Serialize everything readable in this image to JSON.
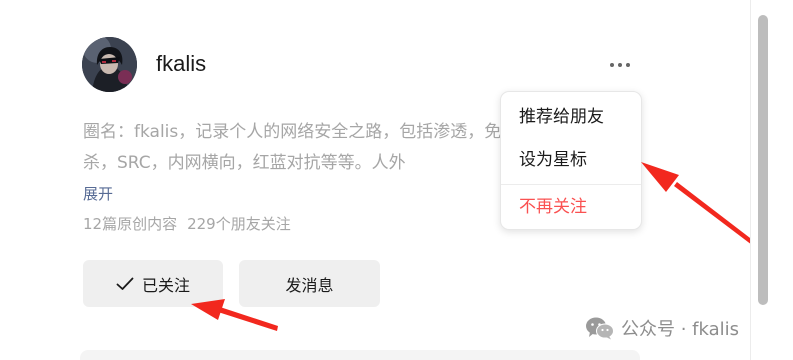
{
  "account": {
    "name": "fkalis",
    "bio": "圈名：fkalis，记录个人的网络安全之路，包括渗透，免杀，SRC，内网横向，红蓝对抗等等。人外",
    "expand_label": "展开",
    "articles": "12篇原创内容",
    "followers": "229个朋友关注"
  },
  "actions": {
    "followed_label": "已关注",
    "message_label": "发消息"
  },
  "menu": {
    "recommend": "推荐给朋友",
    "star": "设为星标",
    "unfollow": "不再关注"
  },
  "watermark": {
    "text": "公众号 · fkalis"
  },
  "colors": {
    "annotation_arrow": "#f2281e",
    "danger": "#fa5151",
    "link": "#576b95"
  }
}
